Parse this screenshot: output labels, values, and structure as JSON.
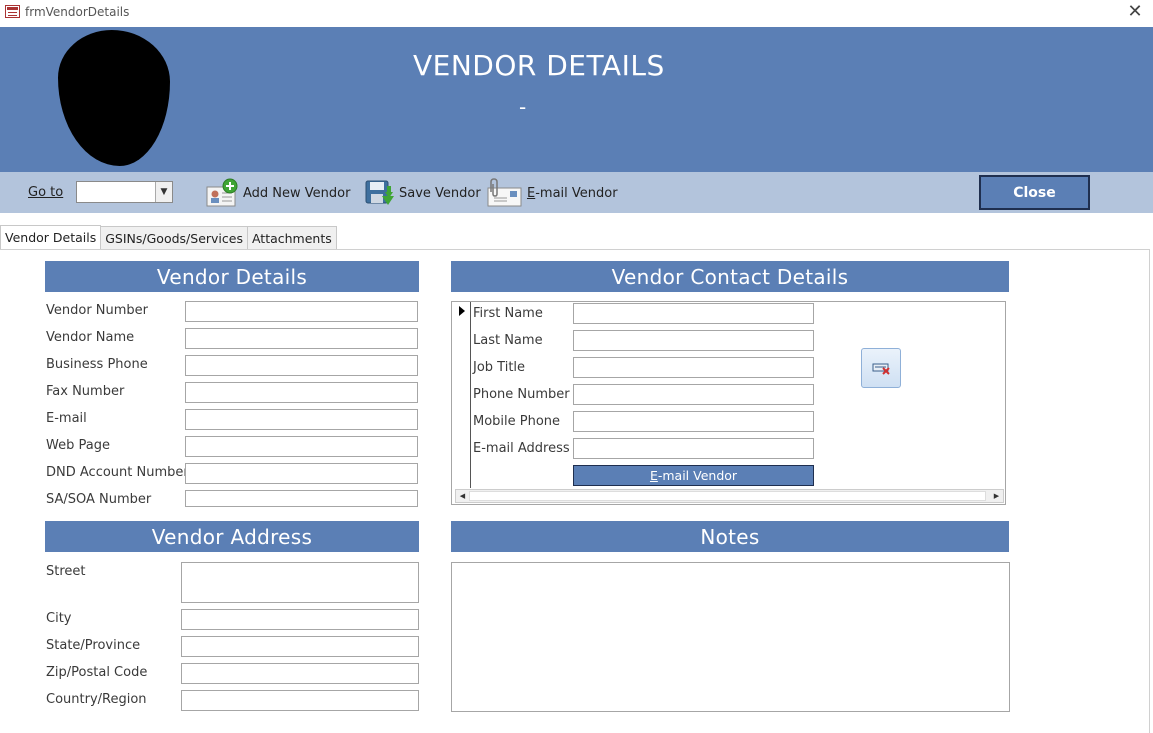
{
  "window": {
    "title": "frmVendorDetails",
    "icon": "form-icon",
    "close_glyph": "✕"
  },
  "header": {
    "title": "VENDOR DETAILS",
    "subtitle": "-"
  },
  "toolbar": {
    "goto_label": "Go to",
    "goto_value": "",
    "add_new_label": "Add New Vendor",
    "save_label": "Save Vendor",
    "email_label": "E-mail Vendor",
    "close_label": "Close"
  },
  "tabs": [
    {
      "label": "Vendor Details",
      "active": true
    },
    {
      "label": "GSINs/Goods/Services",
      "active": false
    },
    {
      "label": "Attachments",
      "active": false
    }
  ],
  "vendor_details": {
    "header": "Vendor Details",
    "fields": [
      {
        "label": "Vendor Number",
        "value": ""
      },
      {
        "label": "Vendor Name",
        "value": ""
      },
      {
        "label": "Business Phone",
        "value": ""
      },
      {
        "label": "Fax Number",
        "value": ""
      },
      {
        "label": "E-mail",
        "value": ""
      },
      {
        "label": "Web Page",
        "value": ""
      },
      {
        "label": "DND Account Number",
        "value": ""
      },
      {
        "label": "SA/SOA Number",
        "value": ""
      }
    ]
  },
  "vendor_contact": {
    "header": "Vendor Contact Details",
    "fields": [
      {
        "label": "First Name",
        "value": ""
      },
      {
        "label": "Last Name",
        "value": ""
      },
      {
        "label": "Job Title",
        "value": ""
      },
      {
        "label": "Phone Number",
        "value": ""
      },
      {
        "label": "Mobile Phone",
        "value": ""
      },
      {
        "label": "E-mail Address",
        "value": ""
      }
    ],
    "email_button": "E-mail Vendor"
  },
  "vendor_address": {
    "header": "Vendor Address",
    "fields": [
      {
        "label": "Street",
        "value": ""
      },
      {
        "label": "City",
        "value": ""
      },
      {
        "label": "State/Province",
        "value": ""
      },
      {
        "label": "Zip/Postal Code",
        "value": ""
      },
      {
        "label": "Country/Region",
        "value": ""
      }
    ]
  },
  "notes": {
    "header": "Notes",
    "value": ""
  },
  "colors": {
    "accent": "#5b7fb5",
    "toolbar": "#b3c4dc",
    "button_border": "#1f2f4f"
  }
}
